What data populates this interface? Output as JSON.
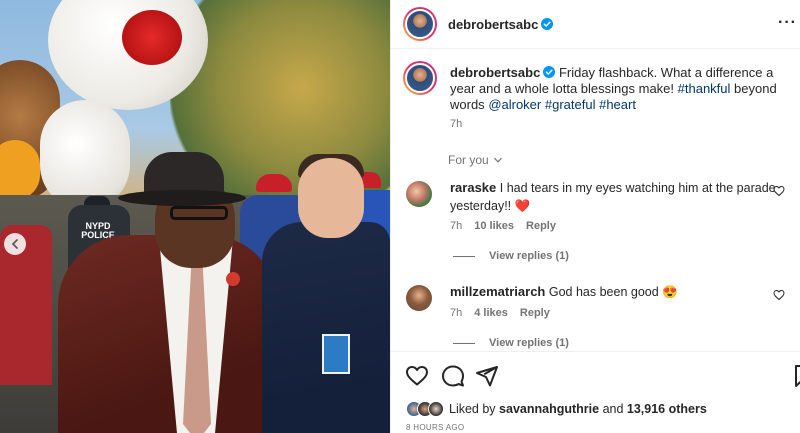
{
  "post": {
    "username": "debrobertsabc",
    "more_label": "···",
    "photo_alt": "Friday flashback photo at the parade",
    "police_label": "NYPD POLICE"
  },
  "caption": {
    "username": "debrobertsabc",
    "text": "Friday flashback. What a difference a year and a whole lotta blessings make!",
    "tag1": "#thankful",
    "middle": "beyond words",
    "mention": "@alroker",
    "tag2": "#grateful",
    "tag3": "#heart",
    "time": "7h"
  },
  "for_you_label": "For you",
  "comments": [
    {
      "username": "raraske",
      "text": "I had tears in my eyes watching him at the parade yesterday!!",
      "emoji": "❤️",
      "time": "7h",
      "likes": "10 likes",
      "reply_label": "Reply",
      "view_replies": "View replies (1)"
    },
    {
      "username": "millzematriarch",
      "text": "God has been good",
      "emoji": "😍",
      "time": "7h",
      "likes": "4 likes",
      "reply_label": "Reply",
      "view_replies": "View replies (1)"
    }
  ],
  "likes": {
    "prefix": "Liked by",
    "user": "savannahguthrie",
    "joiner": "and",
    "others": "13,916 others"
  },
  "posted_ago": "8 HOURS AGO",
  "icons": {
    "verified": "verified-badge-icon",
    "like": "heart-icon",
    "comment": "comment-icon",
    "share": "share-icon",
    "save": "bookmark-icon",
    "carousel_prev": "chevron-left-icon"
  },
  "colors": {
    "verified": "#0095f6",
    "tag": "#00376b",
    "meta": "#737373",
    "text": "#262626",
    "heart_red": "#ed4956"
  }
}
